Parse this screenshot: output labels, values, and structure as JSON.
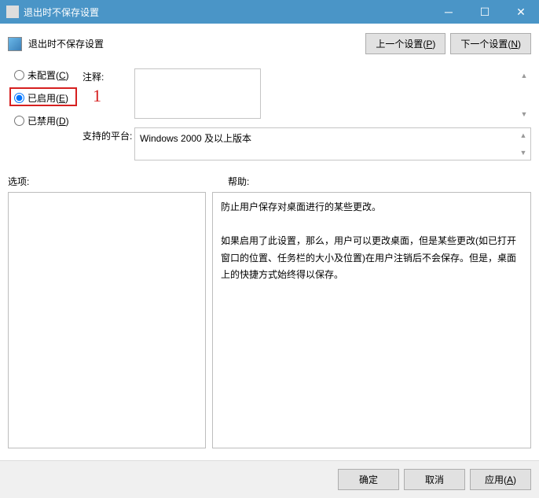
{
  "window": {
    "title": "退出时不保存设置"
  },
  "header": {
    "title": "退出时不保存设置",
    "prev_btn": "上一个设置(P)",
    "next_btn": "下一个设置(N)"
  },
  "radios": {
    "not_configured": "未配置(C)",
    "enabled": "已启用(E)",
    "disabled": "已禁用(D)",
    "selected": "enabled"
  },
  "annotation": {
    "marker": "1"
  },
  "fields": {
    "comment_label": "注释:",
    "comment_value": "",
    "platform_label": "支持的平台:",
    "platform_value": "Windows 2000 及以上版本"
  },
  "sections": {
    "options_label": "选项:",
    "help_label": "帮助:"
  },
  "help": {
    "p1": "防止用户保存对桌面进行的某些更改。",
    "p2": "如果启用了此设置，那么，用户可以更改桌面，但是某些更改(如已打开窗口的位置、任务栏的大小及位置)在用户注销后不会保存。但是，桌面上的快捷方式始终得以保存。"
  },
  "footer": {
    "ok": "确定",
    "cancel": "取消",
    "apply": "应用(A)"
  }
}
